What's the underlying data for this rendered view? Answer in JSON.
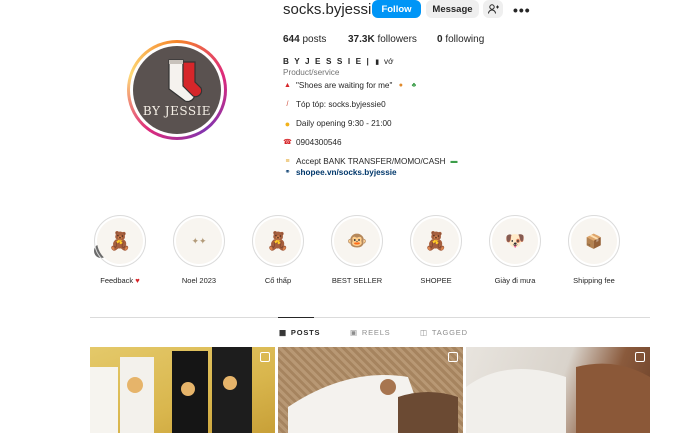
{
  "profile": {
    "username": "socks.byjessie",
    "avatar_text": "BY JESSIE",
    "buttons": {
      "follow": "Follow",
      "message": "Message"
    },
    "stats": {
      "posts_count": "644",
      "posts_label": "posts",
      "followers_count": "37.3K",
      "followers_label": "followers",
      "following_count": "0",
      "following_label": "following"
    },
    "bio": {
      "name": "B Y J E S S I E |",
      "name_suffix": "vớ",
      "category": "Product/service",
      "line1": "\"Shoes are waiting for me\"",
      "line2": "Tóp tóp: socks.byjessie0",
      "line3": "Daily opening 9:30 - 21:00",
      "line4": "0904300546",
      "line5": "Accept BANK TRANSFER/MOMO/CASH",
      "link": "shopee.vn/socks.byjessie"
    }
  },
  "highlights": [
    {
      "label": "Feedback",
      "icon": "bear-icon"
    },
    {
      "label": "Noel 2023",
      "icon": "christmas-icon"
    },
    {
      "label": "Cổ thấp",
      "icon": "bear-icon"
    },
    {
      "label": "BEST SELLER",
      "icon": "monkey-icon"
    },
    {
      "label": "SHOPEE",
      "icon": "bear-icon"
    },
    {
      "label": "Giày đi mưa",
      "icon": "dog-icon"
    },
    {
      "label": "Shipping fee",
      "icon": "shipping-icon"
    }
  ],
  "tabs": {
    "posts": "POSTS",
    "reels": "REELS",
    "tagged": "TAGGED"
  },
  "colors": {
    "follow": "#0095f6",
    "link": "#00376b",
    "text": "#262626",
    "muted": "#737373"
  }
}
